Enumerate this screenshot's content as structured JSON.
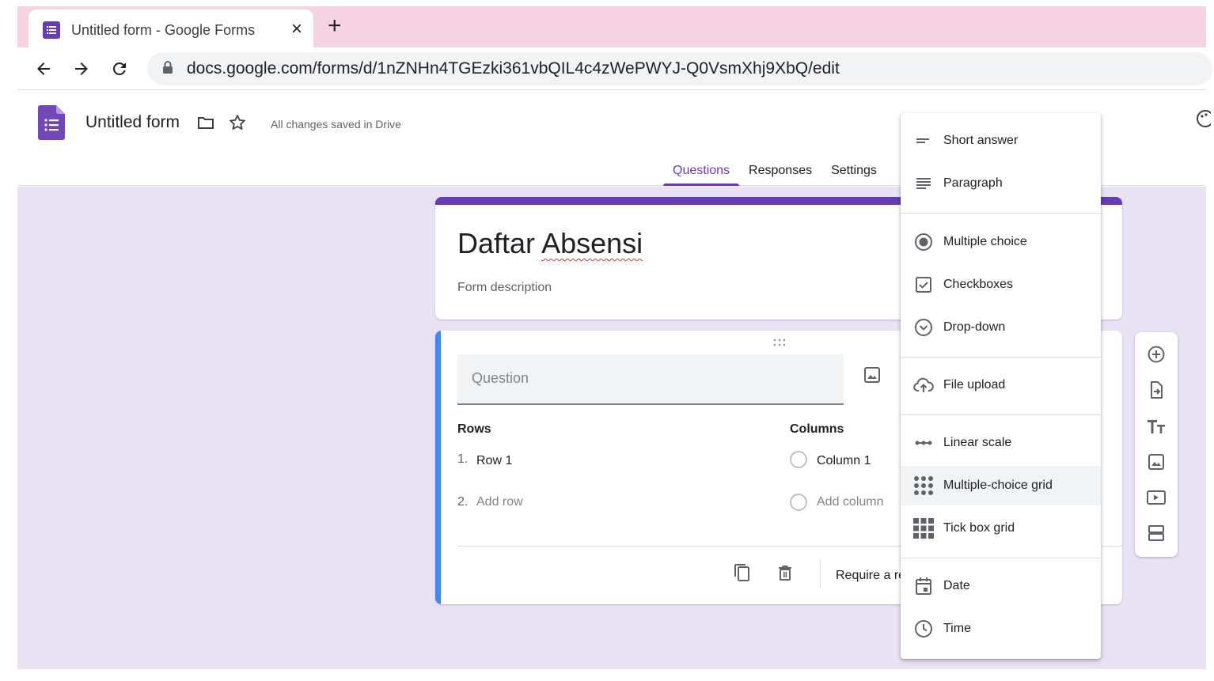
{
  "browser": {
    "tab_title": "Untitled form - Google Forms",
    "close_glyph": "×",
    "new_tab_glyph": "+",
    "url": "docs.google.com/forms/d/1nZNHn4TGEzki361vbQIL4c4zWePWYJ-Q0VsmXhj9XbQ/edit"
  },
  "header": {
    "form_name": "Untitled form",
    "saved_status": "All changes saved in Drive",
    "tabs": [
      {
        "label": "Questions",
        "active": true
      },
      {
        "label": "Responses",
        "active": false
      },
      {
        "label": "Settings",
        "active": false
      }
    ]
  },
  "title_card": {
    "title": "Daftar Absensi",
    "description": "Form description"
  },
  "question_card": {
    "question_placeholder": "Question",
    "rows_label": "Rows",
    "columns_label": "Columns",
    "rows": [
      {
        "num": "1.",
        "label": "Row 1"
      },
      {
        "num": "2.",
        "label": "Add row"
      }
    ],
    "columns": [
      {
        "label": "Column 1"
      },
      {
        "label": "Add column"
      }
    ],
    "require_text": "Require a re"
  },
  "menu": {
    "items": [
      {
        "label": "Short answer",
        "icon": "short-answer-icon"
      },
      {
        "label": "Paragraph",
        "icon": "paragraph-icon"
      },
      {
        "label": "Multiple choice",
        "icon": "radio-icon"
      },
      {
        "label": "Checkboxes",
        "icon": "checkbox-icon"
      },
      {
        "label": "Drop-down",
        "icon": "dropdown-icon"
      },
      {
        "label": "File upload",
        "icon": "cloud-upload-icon"
      },
      {
        "label": "Linear scale",
        "icon": "linear-scale-icon"
      },
      {
        "label": "Multiple-choice grid",
        "icon": "dot-grid-icon",
        "highlighted": true
      },
      {
        "label": "Tick box grid",
        "icon": "square-grid-icon"
      },
      {
        "label": "Date",
        "icon": "calendar-icon"
      },
      {
        "label": "Time",
        "icon": "clock-icon"
      }
    ]
  },
  "colors": {
    "brand": "#673ab7",
    "accent_blue": "#4285f4",
    "canvas": "#e9e2f4",
    "tabstrip": "#f5d3e2"
  }
}
